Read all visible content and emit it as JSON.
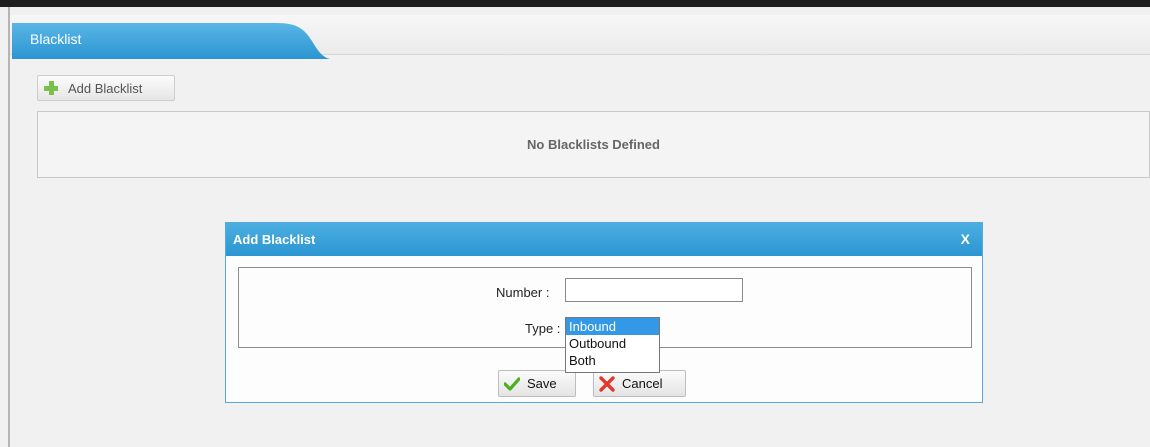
{
  "tab": {
    "label": "Blacklist"
  },
  "toolbar": {
    "add_label": "Add Blacklist"
  },
  "list": {
    "empty_text": "No Blacklists Defined"
  },
  "dialog": {
    "title": "Add Blacklist",
    "close_label": "X",
    "number_label": "Number :",
    "number_value": "",
    "type_label": "Type :",
    "type_options": [
      "Inbound",
      "Outbound",
      "Both"
    ],
    "type_selected": "Inbound",
    "save_label": "Save",
    "cancel_label": "Cancel"
  },
  "colors": {
    "accent": "#2b96d2",
    "tab": "#3aa3db",
    "selected_option": "#3399e6",
    "plus_icon": "#7cc04c",
    "check_icon": "#4caf1e",
    "cancel_icon": "#e0392b"
  },
  "icons": {
    "add": "plus-icon",
    "save": "check-icon",
    "cancel": "x-icon"
  }
}
